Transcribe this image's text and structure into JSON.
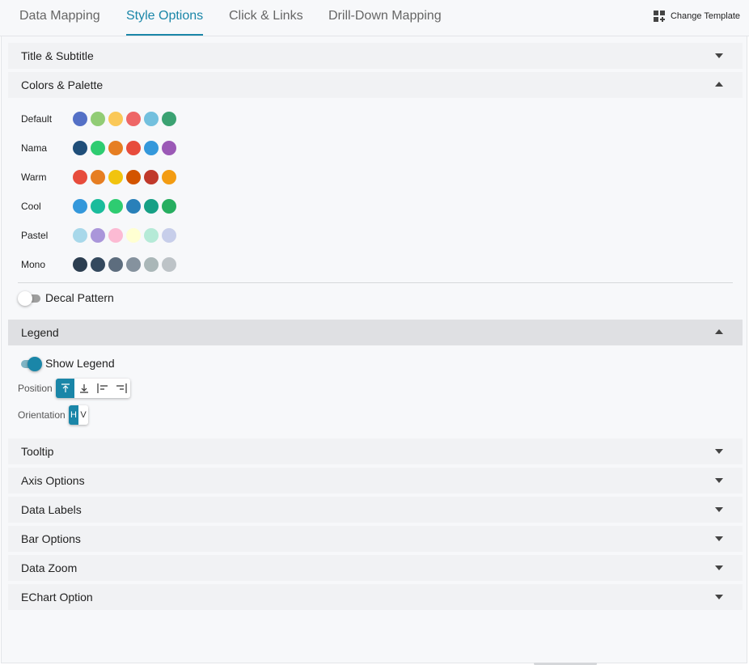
{
  "tabs": [
    {
      "label": "Data Mapping",
      "active": false
    },
    {
      "label": "Style Options",
      "active": true
    },
    {
      "label": "Click & Links",
      "active": false
    },
    {
      "label": "Drill-Down Mapping",
      "active": false
    }
  ],
  "header": {
    "change_template_label": "Change Template",
    "change_template_icon": "grid-plus-icon"
  },
  "sections": {
    "title_subtitle": {
      "label": "Title & Subtitle",
      "expanded": false
    },
    "colors_palette": {
      "label": "Colors & Palette",
      "expanded": true
    },
    "legend": {
      "label": "Legend",
      "expanded": true
    },
    "tooltip": {
      "label": "Tooltip",
      "expanded": false
    },
    "axis_options": {
      "label": "Axis Options",
      "expanded": false
    },
    "data_labels": {
      "label": "Data Labels",
      "expanded": false
    },
    "bar_options": {
      "label": "Bar Options",
      "expanded": false
    },
    "data_zoom": {
      "label": "Data Zoom",
      "expanded": false
    },
    "echart_option": {
      "label": "EChart Option",
      "expanded": false
    }
  },
  "palettes": [
    {
      "name": "Default",
      "colors": [
        "#5470c6",
        "#91cc75",
        "#fac858",
        "#ee6666",
        "#73c0de",
        "#3ba272"
      ]
    },
    {
      "name": "Nama",
      "colors": [
        "#1f4e79",
        "#2ecc71",
        "#e67e22",
        "#e74c3c",
        "#3498db",
        "#9b59b6"
      ]
    },
    {
      "name": "Warm",
      "colors": [
        "#e74c3c",
        "#e67e22",
        "#f1c40f",
        "#d35400",
        "#c0392b",
        "#f39c12"
      ]
    },
    {
      "name": "Cool",
      "colors": [
        "#3498db",
        "#1abc9c",
        "#2ecc71",
        "#2980b9",
        "#16a085",
        "#27ae60"
      ]
    },
    {
      "name": "Pastel",
      "colors": [
        "#a8d8ea",
        "#aa96da",
        "#fcbad3",
        "#ffffd2",
        "#b5ead7",
        "#c7ceea"
      ]
    },
    {
      "name": "Mono",
      "colors": [
        "#2c3e50",
        "#34495e",
        "#5d6d7e",
        "#85929e",
        "#aab7b8",
        "#bdc3c7"
      ]
    }
  ],
  "decal_pattern": {
    "label": "Decal Pattern",
    "enabled": false
  },
  "legend": {
    "show_legend_label": "Show Legend",
    "show_legend_enabled": true,
    "position_label": "Position",
    "position_options": [
      {
        "icon": "align-top-icon",
        "selected": true
      },
      {
        "icon": "align-bottom-icon",
        "selected": false
      },
      {
        "icon": "align-left-icon",
        "selected": false
      },
      {
        "icon": "align-right-icon",
        "selected": false
      }
    ],
    "orientation_label": "Orientation",
    "orientation_options": [
      {
        "label": "H",
        "selected": true
      },
      {
        "label": "V",
        "selected": false
      }
    ]
  },
  "colors": {
    "accent": "#1a86a8",
    "section_bg": "#f1f2f4",
    "section_active_bg": "#dfe0e3"
  }
}
